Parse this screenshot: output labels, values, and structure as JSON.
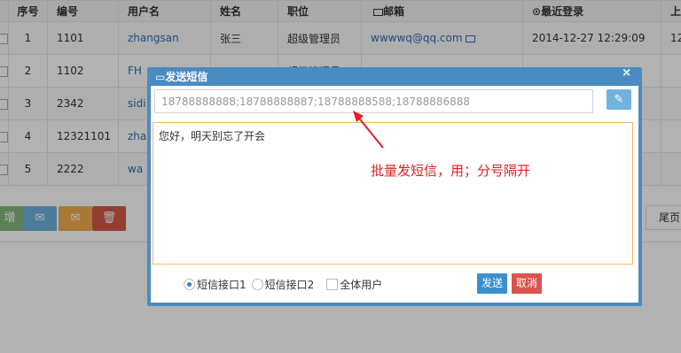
{
  "table": {
    "headers": {
      "index": "序号",
      "code": "编号",
      "username": "用户名",
      "name": "姓名",
      "position": "职位",
      "email": "邮箱",
      "last_login": "最近登录",
      "extra": "上"
    },
    "rows": [
      {
        "index": "1",
        "code": "1101",
        "username": "zhangsan",
        "name": "张三",
        "position": "超级管理员",
        "email": "wwwwq@qq.com",
        "last_login": "2014-12-27 12:29:09",
        "extra": "12"
      },
      {
        "index": "2",
        "code": "1102",
        "username": "FH",
        "name": "",
        "position": "超级管理员",
        "email": "",
        "last_login": "",
        "extra": ""
      },
      {
        "index": "3",
        "code": "2342",
        "username": "sidi",
        "name": "",
        "position": "",
        "email": "",
        "last_login": "",
        "extra": ""
      },
      {
        "index": "4",
        "code": "12321101",
        "username": "zha",
        "name": "",
        "position": "",
        "email": "",
        "last_login": "",
        "extra": ""
      },
      {
        "index": "5",
        "code": "2222",
        "username": "wa",
        "name": "",
        "position": "",
        "email": "",
        "last_login": "",
        "extra": ""
      }
    ]
  },
  "actions": {
    "add_label": "增",
    "colors": {
      "add": "#87b87f",
      "email": "#6fb3e0",
      "email2": "#f0ad4e",
      "delete": "#d15b47"
    }
  },
  "pager": {
    "last_label": "尾页"
  },
  "dialog": {
    "title": "发送短信",
    "close": "×",
    "phones_placeholder": "18788888888;18788888887;18788888588;18788886888",
    "message": "您好，明天别忘了开会",
    "annotation": "批量发短信，用；分号隔开",
    "options": {
      "iface1": "短信接口1",
      "iface2": "短信接口2",
      "all_users": "全体用户"
    },
    "send_label": "发送",
    "cancel_label": "取消",
    "colors": {
      "header": "#4a8bc2",
      "send": "#3a8fd1",
      "cancel": "#d9534f",
      "annotation": "#e02020"
    }
  }
}
